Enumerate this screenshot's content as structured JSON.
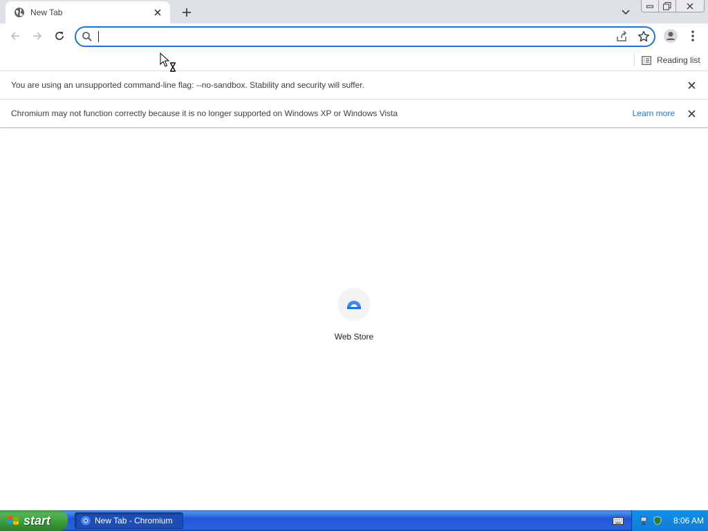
{
  "browser": {
    "tab": {
      "title": "New Tab"
    },
    "omnibox": {
      "value": "",
      "placeholder": ""
    },
    "bookmarks": {
      "reading_list_label": "Reading list"
    },
    "infobars": [
      {
        "message": "You are using an unsupported command-line flag: --no-sandbox. Stability and security will suffer."
      },
      {
        "message": "Chromium may not function correctly because it is no longer supported on Windows XP or Windows Vista",
        "link_label": "Learn more"
      }
    ],
    "shortcuts": [
      {
        "label": "Web Store"
      }
    ]
  },
  "taskbar": {
    "start_label": "start",
    "task_label": "New Tab - Chromium",
    "clock": "8:06 AM"
  },
  "colors": {
    "accent": "#1a73e8",
    "tabstrip": "#dee1e6",
    "taskbar": "#2157d7",
    "start_button": "#3a9b3a"
  }
}
